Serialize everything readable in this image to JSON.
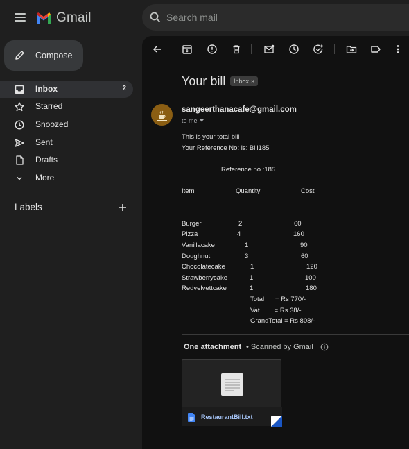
{
  "header": {
    "logo_text": "Gmail",
    "search_placeholder": "Search mail"
  },
  "sidebar": {
    "compose_label": "Compose",
    "items": [
      {
        "label": "Inbox",
        "count": "2",
        "icon": "inbox-icon",
        "active": true
      },
      {
        "label": "Starred",
        "count": "",
        "icon": "star-icon"
      },
      {
        "label": "Snoozed",
        "count": "",
        "icon": "clock-icon"
      },
      {
        "label": "Sent",
        "count": "",
        "icon": "send-icon"
      },
      {
        "label": "Drafts",
        "count": "",
        "icon": "draft-icon"
      },
      {
        "label": "More",
        "count": "",
        "icon": "chevron-down-icon"
      }
    ],
    "labels_title": "Labels"
  },
  "email": {
    "subject": "Your bill",
    "chip_label": "Inbox",
    "chip_close": "×",
    "sender": "sangeerthanacafe@gmail.com",
    "to_me": "to me",
    "intro": "This is your total bill",
    "reference_line": "Your Reference No: is: Bill185",
    "reference_no": "Reference.no :185",
    "columns": [
      "Item",
      "Quantity",
      "Cost"
    ],
    "items": [
      {
        "name": "Burger",
        "qty": "2",
        "cost": "60"
      },
      {
        "name": "Pizza",
        "qty": "4",
        "cost": "160"
      },
      {
        "name": "Vanillacake",
        "qty": "1",
        "cost": "90"
      },
      {
        "name": "Doughnut",
        "qty": "3",
        "cost": "60"
      },
      {
        "name": "Chocolatecake",
        "qty": "1",
        "cost": "120"
      },
      {
        "name": "Strawberrycake",
        "qty": "1",
        "cost": "100"
      },
      {
        "name": "Redvelvettcake",
        "qty": "1",
        "cost": "180"
      }
    ],
    "total": "Total      = Rs 770/-",
    "vat": "Vat        = Rs 38/-",
    "grand_total": "GrandTotal = Rs 808/-"
  },
  "attachment": {
    "title": "One attachment",
    "scan_note": "• Scanned by Gmail",
    "file_name": "RestaurantBill.txt"
  },
  "colors": {
    "page_bg": "#1f1f1f",
    "content_bg": "#111111",
    "accent_link": "#a8c7fa",
    "avatar_bg": "#8b5e13"
  }
}
